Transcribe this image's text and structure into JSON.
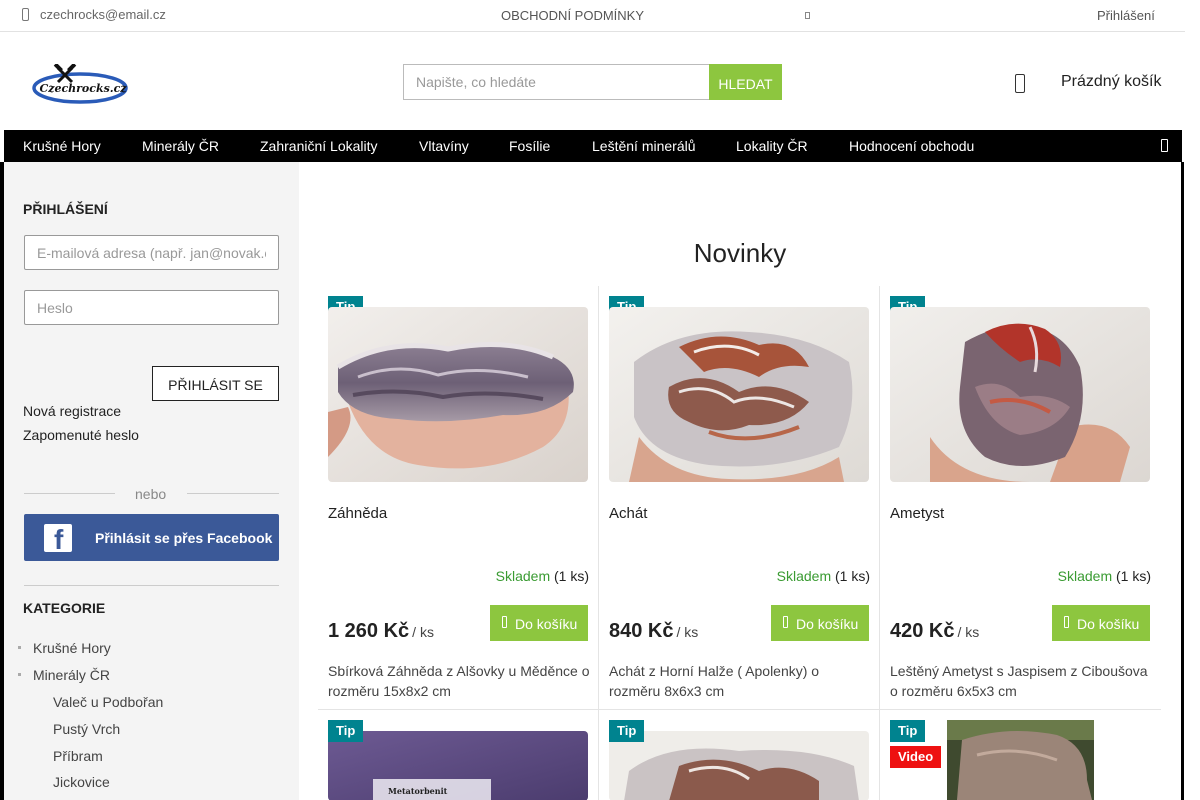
{
  "topbar": {
    "email": "czechrocks@email.cz",
    "terms": "OBCHODNÍ PODMÍNKY",
    "login": "Přihlášení"
  },
  "header": {
    "logo_text": "Czechrocks.cz",
    "search_placeholder": "Napište, co hledáte",
    "search_button": "HLEDAT",
    "cart_label": "Prázdný košík"
  },
  "nav": {
    "items": [
      {
        "label": "Krušné Hory"
      },
      {
        "label": "Minerály ČR"
      },
      {
        "label": "Zahraniční Lokality"
      },
      {
        "label": "Vltavíny"
      },
      {
        "label": "Fosílie"
      },
      {
        "label": "Leštění minerálů"
      },
      {
        "label": "Lokality ČR"
      },
      {
        "label": "Hodnocení obchodu"
      }
    ]
  },
  "sidebar": {
    "login_title": "PŘIHLÁŠENÍ",
    "email_placeholder": "E-mailová adresa (např. jan@novak.cz)",
    "password_placeholder": "Heslo",
    "login_button": "PŘIHLÁSIT SE",
    "register_link": "Nová registrace",
    "forgot_link": "Zapomenuté heslo",
    "or_text": "nebo",
    "facebook_button": "Přihlásit se přes Facebook",
    "categories_title": "KATEGORIE",
    "categories": [
      {
        "label": "Krušné Hory"
      },
      {
        "label": "Minerály ČR"
      }
    ],
    "subcategories": [
      {
        "label": "Valeč u Podbořan"
      },
      {
        "label": "Pustý Vrch"
      },
      {
        "label": "Příbram"
      },
      {
        "label": "Jickovice"
      }
    ]
  },
  "main": {
    "heading": "Novinky",
    "products": [
      {
        "badge": "Tip",
        "name": "Záhněda",
        "stock_status": "Skladem",
        "stock_count": "(1 ks)",
        "price": "1 260 Kč",
        "unit": "/ ks",
        "button": "Do košíku",
        "description": "Sbírková Záhněda z Alšovky u Měděnce o rozměru  15x8x2 cm"
      },
      {
        "badge": "Tip",
        "name": "Achát",
        "stock_status": "Skladem",
        "stock_count": "(1 ks)",
        "price": "840 Kč",
        "unit": "/ ks",
        "button": "Do košíku",
        "description": "Achát z Horní Halže ( Apolenky) o rozměru 8x6x3 cm"
      },
      {
        "badge": "Tip",
        "name": "Ametyst",
        "stock_status": "Skladem",
        "stock_count": "(1 ks)",
        "price": "420 Kč",
        "unit": "/ ks",
        "button": "Do košíku",
        "description": "Leštěný Ametyst s Jaspisem z Ciboušova o rozměru 6x5x3 cm"
      }
    ],
    "next_row": [
      {
        "badge": "Tip",
        "label_text": "Metatorbenit"
      },
      {
        "badge": "Tip"
      },
      {
        "badge": "Tip",
        "badge2": "Video"
      }
    ]
  },
  "colors": {
    "accent_green": "#8dc63f",
    "stock_green": "#3a9b32",
    "tip_badge": "#00838f",
    "video_badge": "#ee1111",
    "facebook_blue": "#3b5998",
    "nav_background": "#000000"
  }
}
